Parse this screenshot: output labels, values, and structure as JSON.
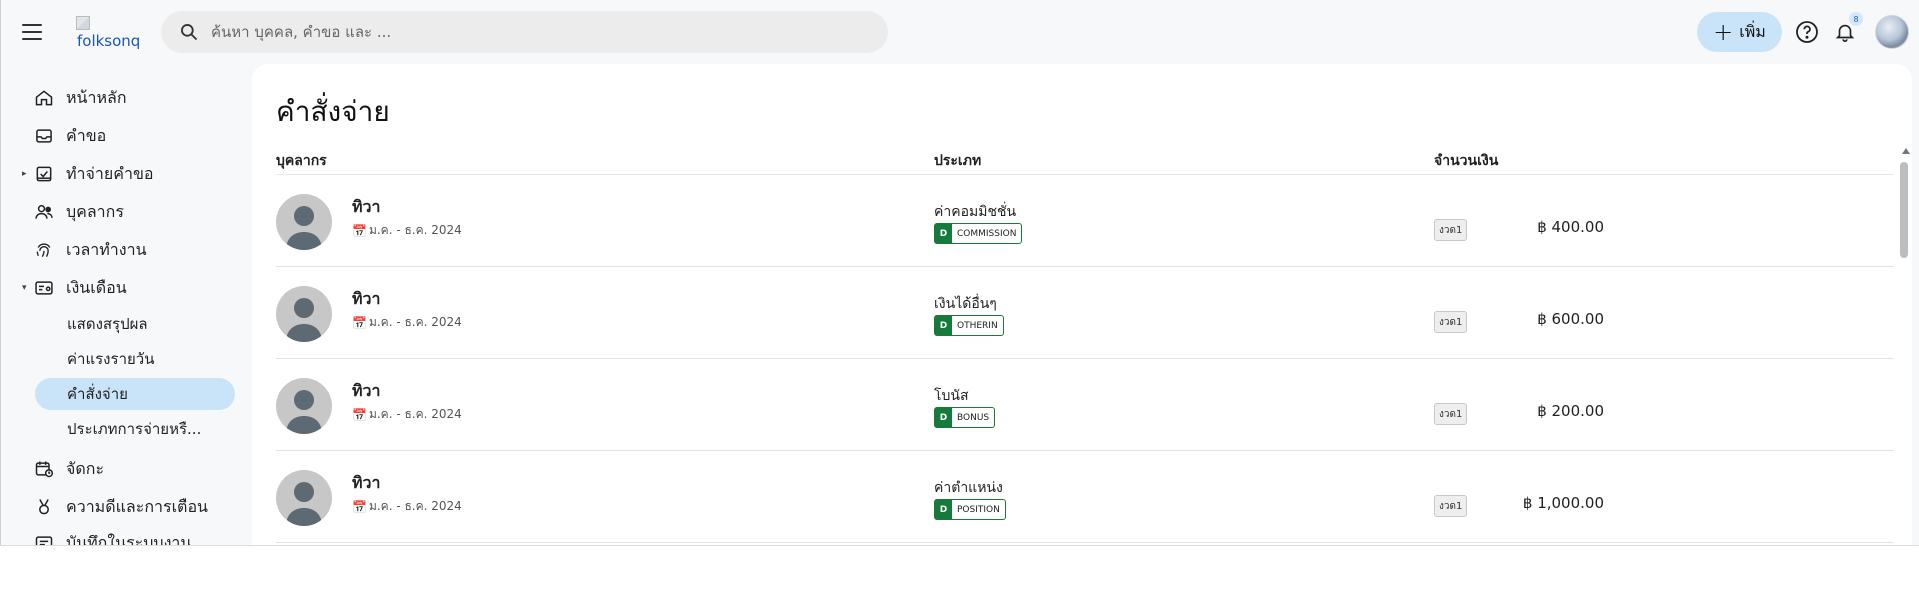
{
  "app": {
    "logo_text": "folksonq",
    "search_placeholder": "ค้นหา บุคคล, คำขอ และ ...",
    "add_label": "เพิ่ม",
    "notification_count": "8"
  },
  "sidebar": {
    "items": [
      {
        "label": "หน้าหลัก",
        "icon": "home-icon"
      },
      {
        "label": "คำขอ",
        "icon": "inbox-icon"
      },
      {
        "label": "ทำจ่ายคำขอ",
        "icon": "payout-icon"
      },
      {
        "label": "บุคลากร",
        "icon": "people-icon"
      },
      {
        "label": "เวลาทำงาน",
        "icon": "fingerprint-icon"
      },
      {
        "label": "เงินเดือน",
        "icon": "salary-icon"
      },
      {
        "label": "จัดกะ",
        "icon": "calendar-shift-icon"
      },
      {
        "label": "ความดีและการเตือน",
        "icon": "medal-icon"
      },
      {
        "label": "บันทึกในระบบงาน",
        "icon": "log-icon"
      }
    ],
    "salary_sub": [
      {
        "label": "แสดงสรุปผล"
      },
      {
        "label": "ค่าแรงรายวัน"
      },
      {
        "label": "คำสั่งจ่าย"
      },
      {
        "label": "ประเภทการจ่ายหรื..."
      }
    ]
  },
  "main": {
    "title": "คำสั่งจ่าย",
    "columns": {
      "person": "บุคลากร",
      "type": "ประเภท",
      "amount": "จำนวนเงิน"
    },
    "rows": [
      {
        "name": "ทิวา",
        "period": "ม.ค. - ธ.ค. 2024",
        "type": "ค่าคอมมิชชั่น",
        "code": "COMMISSION",
        "code_prefix": "D",
        "installment": "งวด1",
        "amount": "฿ 400.00"
      },
      {
        "name": "ทิวา",
        "period": "ม.ค. - ธ.ค. 2024",
        "type": "เงินได้อื่นๆ",
        "code": "OTHERIN",
        "code_prefix": "D",
        "installment": "งวด1",
        "amount": "฿ 600.00"
      },
      {
        "name": "ทิวา",
        "period": "ม.ค. - ธ.ค. 2024",
        "type": "โบนัส",
        "code": "BONUS",
        "code_prefix": "D",
        "installment": "งวด1",
        "amount": "฿ 200.00"
      },
      {
        "name": "ทิวา",
        "period": "ม.ค. - ธ.ค. 2024",
        "type": "ค่าตำแหน่ง",
        "code": "POSITION",
        "code_prefix": "D",
        "installment": "งวด1",
        "amount": "฿ 1,000.00"
      }
    ]
  },
  "colors": {
    "active_bg": "#c9e3f9",
    "code_green": "#157a3b"
  }
}
